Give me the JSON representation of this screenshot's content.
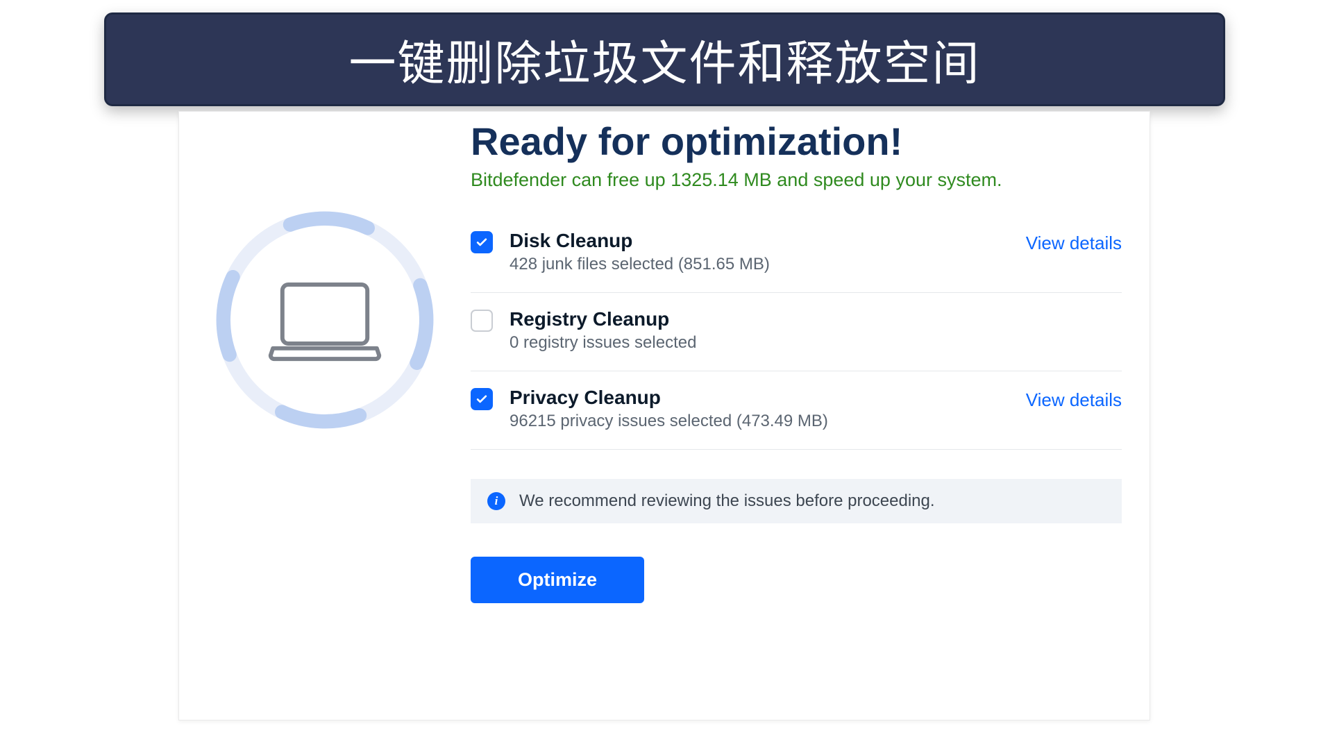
{
  "banner": {
    "title": "一键删除垃圾文件和释放空间"
  },
  "main": {
    "headline": "Ready for optimization!",
    "subhead": "Bitdefender can free up 1325.14 MB and speed up your system.",
    "items": [
      {
        "checked": true,
        "title": "Disk Cleanup",
        "subtitle": "428 junk files selected (851.65 MB)",
        "link": "View details"
      },
      {
        "checked": false,
        "title": "Registry Cleanup",
        "subtitle": "0 registry issues selected",
        "link": ""
      },
      {
        "checked": true,
        "title": "Privacy Cleanup",
        "subtitle": "96215 privacy issues selected (473.49 MB)",
        "link": "View details"
      }
    ],
    "info": "We recommend reviewing the issues before proceeding.",
    "optimize_label": "Optimize"
  }
}
